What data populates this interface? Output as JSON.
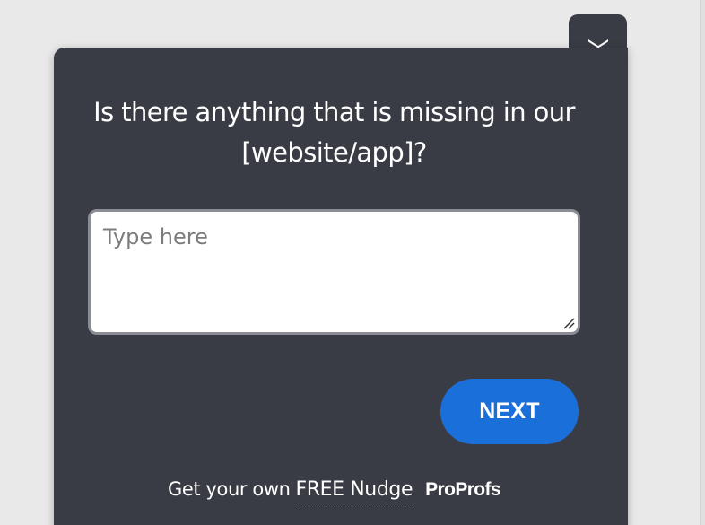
{
  "widget": {
    "question": "Is there anything that is missing in our [website/app]?",
    "answer_placeholder": "Type here",
    "answer_value": "",
    "next_label": "NEXT",
    "collapse_icon": "chevron-down-icon",
    "colors": {
      "panel_background": "#393c44",
      "button_background": "#1b6fd8",
      "text": "#ffffff",
      "page_background": "#e9e9e9"
    }
  },
  "footer": {
    "prefix": "Get your own",
    "link_label": "FREE Nudge",
    "brand": "ProProfs"
  }
}
